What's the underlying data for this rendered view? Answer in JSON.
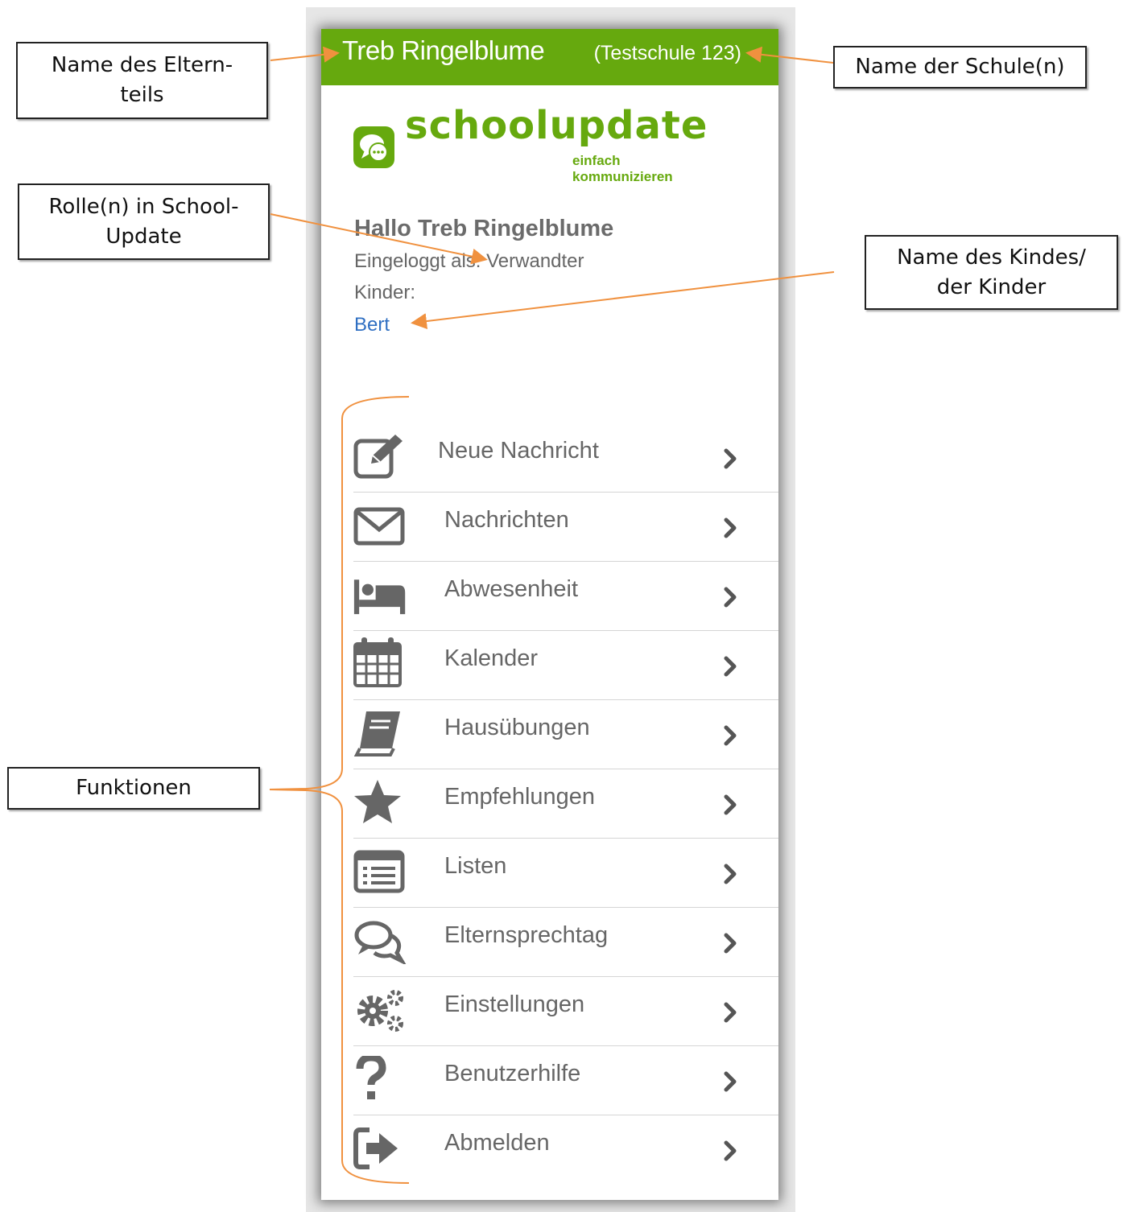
{
  "annotations": {
    "parent_name": [
      "Name des Eltern-",
      "teils"
    ],
    "school_name": [
      "Name der Schule(n)"
    ],
    "roles": [
      "Rolle(n) in School-",
      "Update"
    ],
    "child_name": [
      "Name des Kindes/",
      "der Kinder"
    ],
    "functions": [
      "Funktionen"
    ]
  },
  "colors": {
    "brand_green": "#66a90e",
    "arrow_orange": "#f0913f",
    "link_blue": "#2f6fc2",
    "icon_gray": "#666666"
  },
  "header": {
    "user_name": "Treb Ringelblume",
    "school": "(Testschule 123)"
  },
  "logo": {
    "word": "schoolupdate",
    "tagline": "einfach kommunizieren"
  },
  "greeting": {
    "title": "Hallo Treb Ringelblume",
    "role": "Eingeloggt als: Verwandter",
    "children_label": "Kinder:",
    "children": [
      "Bert"
    ]
  },
  "menu": [
    {
      "label": "Neue Nachricht",
      "icon": "edit-icon"
    },
    {
      "label": "Nachrichten",
      "icon": "envelope-icon"
    },
    {
      "label": "Abwesenheit",
      "icon": "bed-icon"
    },
    {
      "label": "Kalender",
      "icon": "calendar-icon"
    },
    {
      "label": "Hausübungen",
      "icon": "book-icon"
    },
    {
      "label": "Empfehlungen",
      "icon": "star-icon"
    },
    {
      "label": "Listen",
      "icon": "list-icon"
    },
    {
      "label": "Elternsprechtag",
      "icon": "chat-icon"
    },
    {
      "label": "Einstellungen",
      "icon": "gears-icon"
    },
    {
      "label": "Benutzerhilfe",
      "icon": "question-icon"
    },
    {
      "label": "Abmelden",
      "icon": "sign-out-icon"
    }
  ]
}
